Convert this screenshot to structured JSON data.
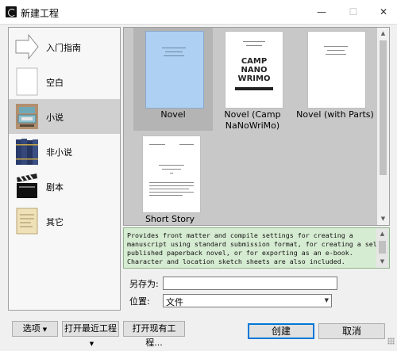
{
  "window": {
    "title": "新建工程",
    "minimize": "—",
    "maximize": "☐",
    "close": "✕"
  },
  "sidebar": {
    "items": [
      {
        "label": "入门指南",
        "icon": "arrow-right-icon"
      },
      {
        "label": "空白",
        "icon": "blank-page-icon"
      },
      {
        "label": "小说",
        "icon": "typewriter-icon",
        "selected": true
      },
      {
        "label": "非小说",
        "icon": "books-icon"
      },
      {
        "label": "剧本",
        "icon": "clapperboard-icon"
      },
      {
        "label": "其它",
        "icon": "parchment-icon"
      }
    ]
  },
  "templates": [
    {
      "label": "Novel",
      "selected": true
    },
    {
      "label": "Novel (Camp\nNaNoWriMo)",
      "cover_text": "CAMP\nNANO\nWRIMO"
    },
    {
      "label": "Novel (with Parts)"
    },
    {
      "label": "Short Story"
    }
  ],
  "description": "Provides front matter and compile settings for creating a\nmanuscript using standard submission format, for creating a self-\npublished paperback novel, or for exporting as an e-book.\nCharacter and location sketch sheets are also included.",
  "form": {
    "save_as_label": "另存为:",
    "save_as_value": "",
    "location_label": "位置:",
    "location_value": "文件"
  },
  "buttons": {
    "options": "选项",
    "open_recent": "打开最近工程",
    "open_existing": "打开现有工程...",
    "create": "创建",
    "cancel": "取消"
  },
  "colors": {
    "accent": "#0078d7",
    "selected_thumb": "#aed0f2",
    "description_bg": "#d6ecd2"
  }
}
